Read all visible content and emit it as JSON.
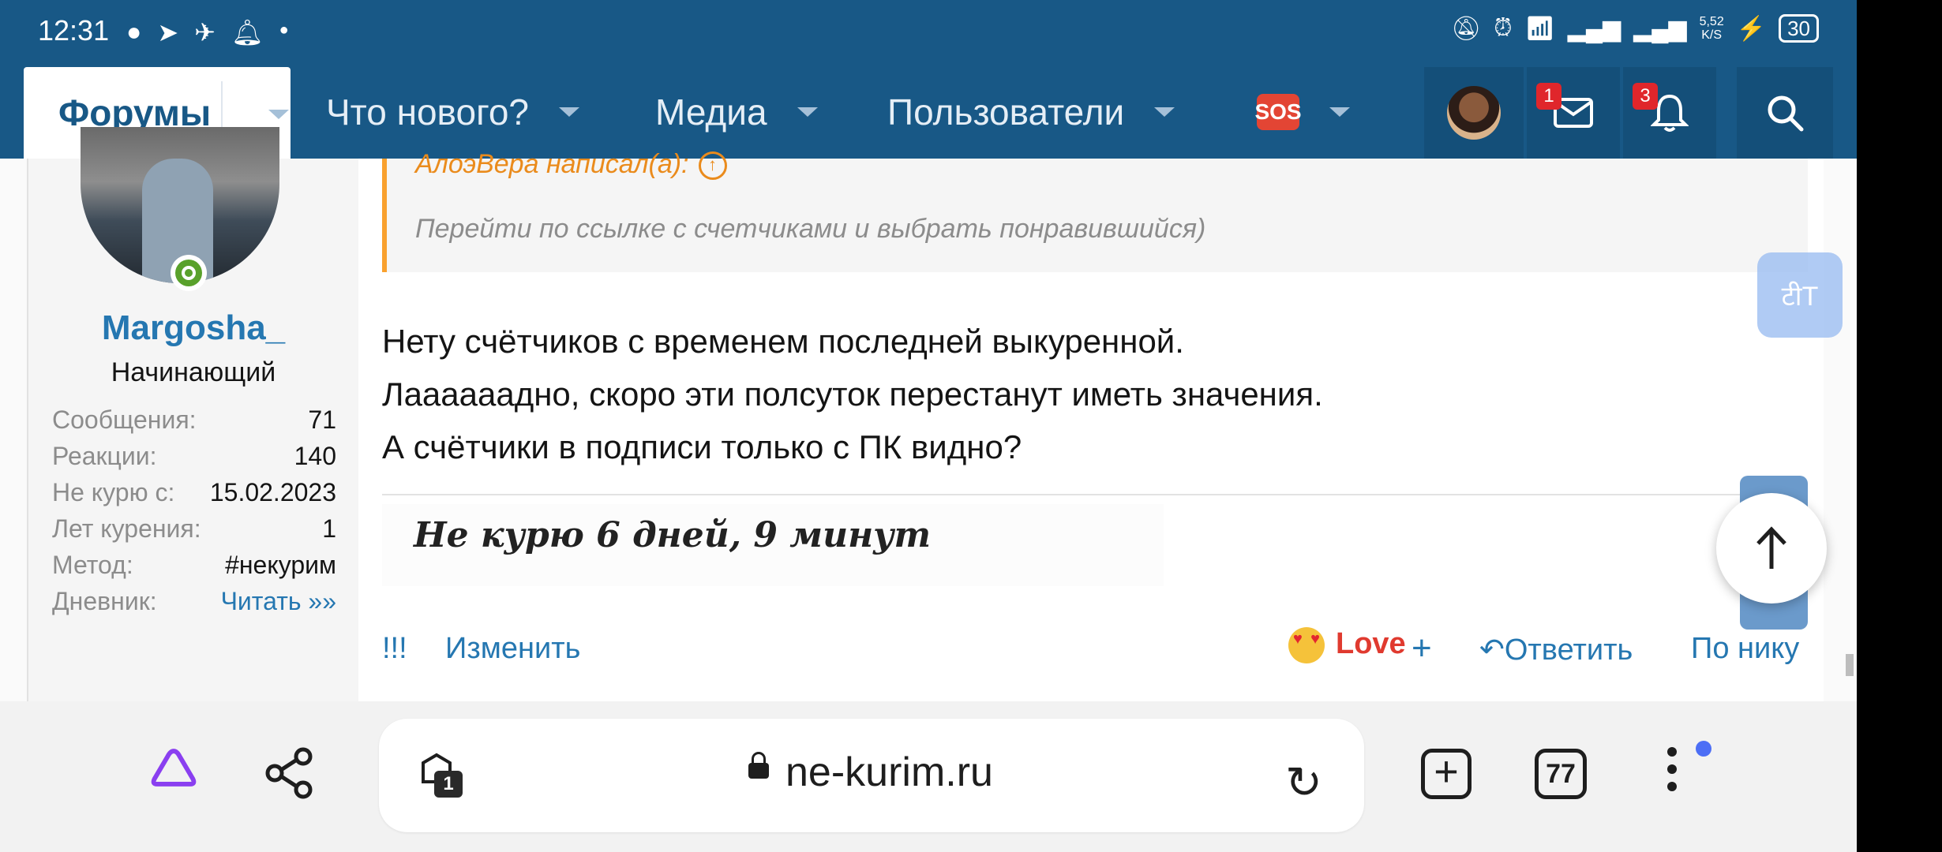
{
  "status_bar": {
    "time": "12:31",
    "net_speed_value": "5,52",
    "net_speed_unit": "K/S",
    "battery": "30"
  },
  "nav": {
    "forums": "Форумы",
    "whats_new": "Что нового?",
    "media": "Медиа",
    "users": "Пользователи",
    "sos": "SOS",
    "messages_badge": "1",
    "alerts_badge": "3"
  },
  "user": {
    "username": "Margosha_",
    "title": "Начинающий",
    "stats": [
      {
        "label": "Сообщения:",
        "value": "71"
      },
      {
        "label": "Реакции:",
        "value": "140"
      },
      {
        "label": "Не курю с:",
        "value": "15.02.2023"
      },
      {
        "label": "Лет курения:",
        "value": "1"
      },
      {
        "label": "Метод:",
        "value": "#некурим"
      },
      {
        "label": "Дневник:",
        "value": "Читать »»"
      }
    ]
  },
  "post": {
    "quote_author": "АлоэВера написал(а):",
    "quote_text": "Перейти по ссылке с счетчиками и выбрать понравившийся)",
    "lines": [
      "Нету счётчиков с временем последней выкуренной.",
      "Лаааааадно, скоро эти полсуток перестанут иметь значения.",
      "А счётчики в подписи только с ПК видно?"
    ],
    "signature": "Не курю 6 дней, 9 минут"
  },
  "actions": {
    "report": "!!!",
    "edit": "Изменить",
    "love": "Love",
    "plus": "+",
    "reply": "Ответить",
    "by_nick": "По нику"
  },
  "browser": {
    "url": "ne-kurim.ru",
    "tab_badge": "1",
    "tabs_count": "77"
  },
  "colors": {
    "nav_bg": "#185886",
    "link": "#2577b1",
    "quote_accent": "#f9a12e",
    "love": "#e03a2f"
  }
}
